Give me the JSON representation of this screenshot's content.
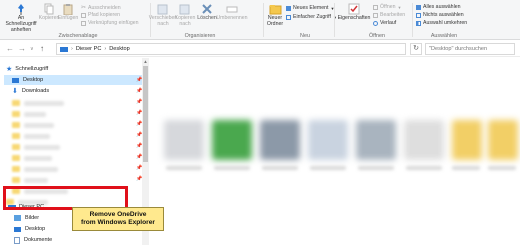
{
  "ribbon": {
    "pin_quick_access": "An Schnellzugriff anheften",
    "copy": "Kopieren",
    "paste": "Einfügen",
    "cut": "Ausschneiden",
    "copy_path": "Pfad kopieren",
    "paste_shortcut": "Verknüpfung einfügen",
    "clipboard_group": "Zwischenablage",
    "move_to": "Verschieben nach",
    "copy_to": "Kopieren nach",
    "delete": "Löschen",
    "rename": "Umbenennen",
    "organize_group": "Organisieren",
    "new_folder": "Neuer Ordner",
    "new_item": "Neues Element",
    "easy_access": "Einfacher Zugriff",
    "new_group": "Neu",
    "properties": "Eigenschaften",
    "open": "Öffnen",
    "edit": "Bearbeiten",
    "history": "Verlauf",
    "open_group": "Öffnen",
    "select_all": "Alles auswählen",
    "select_none": "Nichts auswählen",
    "invert_selection": "Auswahl umkehren",
    "select_group": "Auswählen"
  },
  "address": {
    "path": [
      "Dieser PC",
      "Desktop"
    ],
    "search_placeholder": "\"Desktop\" durchsuchen"
  },
  "nav": {
    "quick_access": "Schnellzugriff",
    "desktop": "Desktop",
    "downloads": "Downloads",
    "this_pc": "Dieser PC",
    "pictures": "Bilder",
    "desktop2": "Desktop",
    "documents": "Dokumente"
  },
  "callout": {
    "line1": "Remove OneDrive",
    "line2": "from Windows Explorer"
  },
  "colors": {
    "highlight_border": "#e0101a",
    "callout_bg": "#ffe98e",
    "selection": "#cce8ff"
  }
}
